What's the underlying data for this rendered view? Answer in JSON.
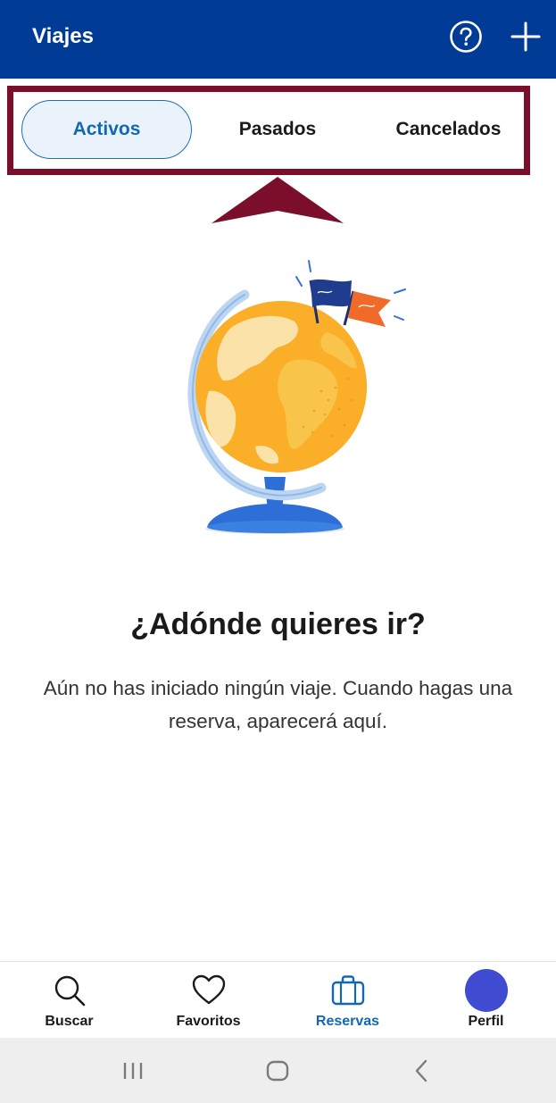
{
  "appbar": {
    "title": "Viajes",
    "help_icon": "question-circle-icon",
    "add_icon": "plus-icon",
    "background": "#003b95"
  },
  "tabs": [
    {
      "label": "Activos",
      "selected": true
    },
    {
      "label": "Pasados",
      "selected": false
    },
    {
      "label": "Cancelados",
      "selected": false
    }
  ],
  "annotation": {
    "color": "#7b0f2b",
    "shape": "box-with-arrow"
  },
  "empty_state": {
    "illustration": "globe-with-flags",
    "headline": "¿Adónde quieres ir?",
    "message": "Aún no has iniciado ningún viaje. Cuando hagas una reserva, aparecerá aquí."
  },
  "bottom_nav": [
    {
      "label": "Buscar",
      "icon": "search-icon",
      "active": false
    },
    {
      "label": "Favoritos",
      "icon": "heart-icon",
      "active": false
    },
    {
      "label": "Reservas",
      "icon": "suitcase-icon",
      "active": true
    },
    {
      "label": "Perfil",
      "icon": "avatar",
      "active": false
    }
  ],
  "system_nav": [
    "recent-apps-icon",
    "home-icon",
    "back-icon"
  ],
  "colors": {
    "accent": "#1467b3",
    "avatar": "#3f4bd1"
  }
}
